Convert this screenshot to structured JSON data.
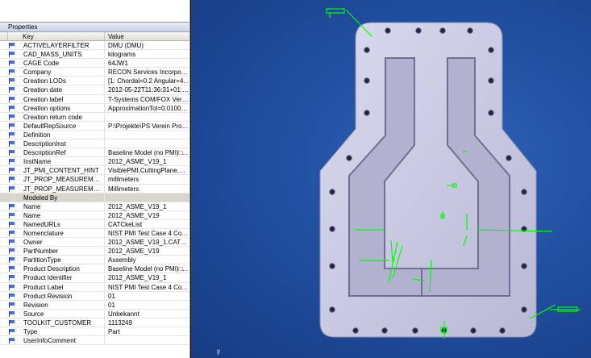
{
  "panel": {
    "title": "Properties",
    "col_key": "Key",
    "col_value": "Value"
  },
  "rows": [
    {
      "key": "ACTIVELAYERFILTER",
      "value": "DMU (DMU)"
    },
    {
      "key": "CAD_MASS_UNITS",
      "value": "kilograms"
    },
    {
      "key": "CAGE Code",
      "value": "64JW1"
    },
    {
      "key": "Company",
      "value": "RECON Services Incorporated"
    },
    {
      "key": "Creation LODs",
      "value": "[1: Chordal=0.2 Angular=4..."
    },
    {
      "key": "Creation date",
      "value": "2012-05-22T11:36:31+01:00"
    },
    {
      "key": "Creation label",
      "value": "T-Systems COM/FOX Versio..."
    },
    {
      "key": "Creation options",
      "value": "ApproximationTol=0.01000..."
    },
    {
      "key": "Creation return code",
      "value": ""
    },
    {
      "key": "DefaultRepSource",
      "value": "P:\\Projekte\\PS Verein Proje..."
    },
    {
      "key": "Definition",
      "value": ""
    },
    {
      "key": "DescriptionInst",
      "value": ""
    },
    {
      "key": "DescriptionRef",
      "value": "Baseline Model (no PMI)□..."
    },
    {
      "key": "InstName",
      "value": "2012_ASME_V19_1"
    },
    {
      "key": "JT_PMI_CONTENT_HINT",
      "value": "VisiblePMI,CuttingPlane,Mo..."
    },
    {
      "key": "JT_PROP_MEASUREMENT_...",
      "value": "millimeters"
    },
    {
      "key": "JT_PROP_MEASUREMENT_...",
      "value": "Millimeters"
    },
    {
      "key": "Modeled By",
      "value": "",
      "group": true
    },
    {
      "key": "Name",
      "value": "2012_ASME_V19_1"
    },
    {
      "key": "Name",
      "value": "2012_ASME_V19"
    },
    {
      "key": "NamedURLs",
      "value": "CATCkeList"
    },
    {
      "key": "Nomenclature",
      "value": "NIST PMI Test Case 4 Comp..."
    },
    {
      "key": "Owner",
      "value": "2012_ASME_V19_1.CATPart"
    },
    {
      "key": "PartNumber",
      "value": "2012_ASME_V19"
    },
    {
      "key": "PartitionType",
      "value": "Assembly"
    },
    {
      "key": "Product Description",
      "value": "Baseline Model (no PMI)□..."
    },
    {
      "key": "Product Identifier",
      "value": "2012_ASME_V19_1"
    },
    {
      "key": "Product Label",
      "value": "NIST PMI Test Case 4 Comp..."
    },
    {
      "key": "Product Revision",
      "value": "01"
    },
    {
      "key": "Revision",
      "value": "01"
    },
    {
      "key": "Source",
      "value": "Unbekannt"
    },
    {
      "key": "TOOLKIT_CUSTOMER",
      "value": "1113249"
    },
    {
      "key": "Type",
      "value": "Part"
    },
    {
      "key": "UserInfoComment",
      "value": ""
    }
  ],
  "viewport": {
    "axis_label": "y",
    "background": "#1f4c9c",
    "part_color": "#c9c9e0",
    "pmi_color": "#00ff00"
  }
}
